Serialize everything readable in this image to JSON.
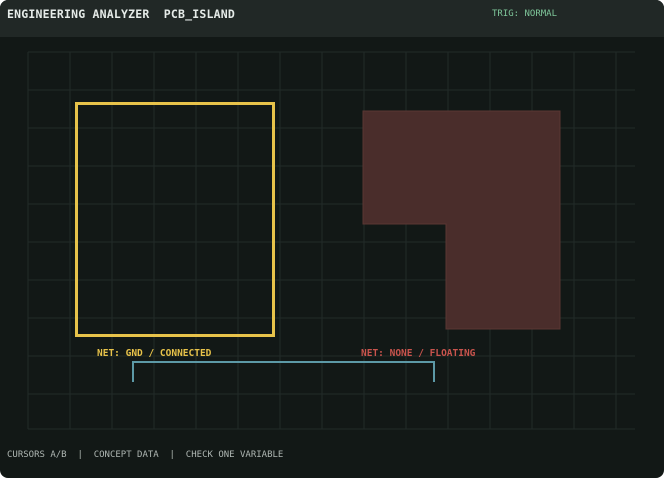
{
  "header": {
    "title": "ENGINEERING ANALYZER  PCB_ISLAND",
    "trigger_status": "TRIG: NORMAL"
  },
  "canvas": {
    "island_a": {
      "net_label": "NET: GND / CONNECTED",
      "outline_color": "#e8c34a"
    },
    "island_b": {
      "net_label": "NET: NONE / FLOATING",
      "fill_color": "#4a2d2b",
      "label_color": "#c9544d"
    },
    "bracket_color": "#5c99a6",
    "grid_color": "#222b28"
  },
  "footer": {
    "status": "CURSORS A/B  |  CONCEPT DATA  |  CHECK ONE VARIABLE"
  },
  "colors": {
    "window_bg": "#121816",
    "header_bg": "#212826",
    "title_text": "#e6ece9",
    "trigger_text": "#7fc79b",
    "footer_text": "#aeb6b2"
  }
}
